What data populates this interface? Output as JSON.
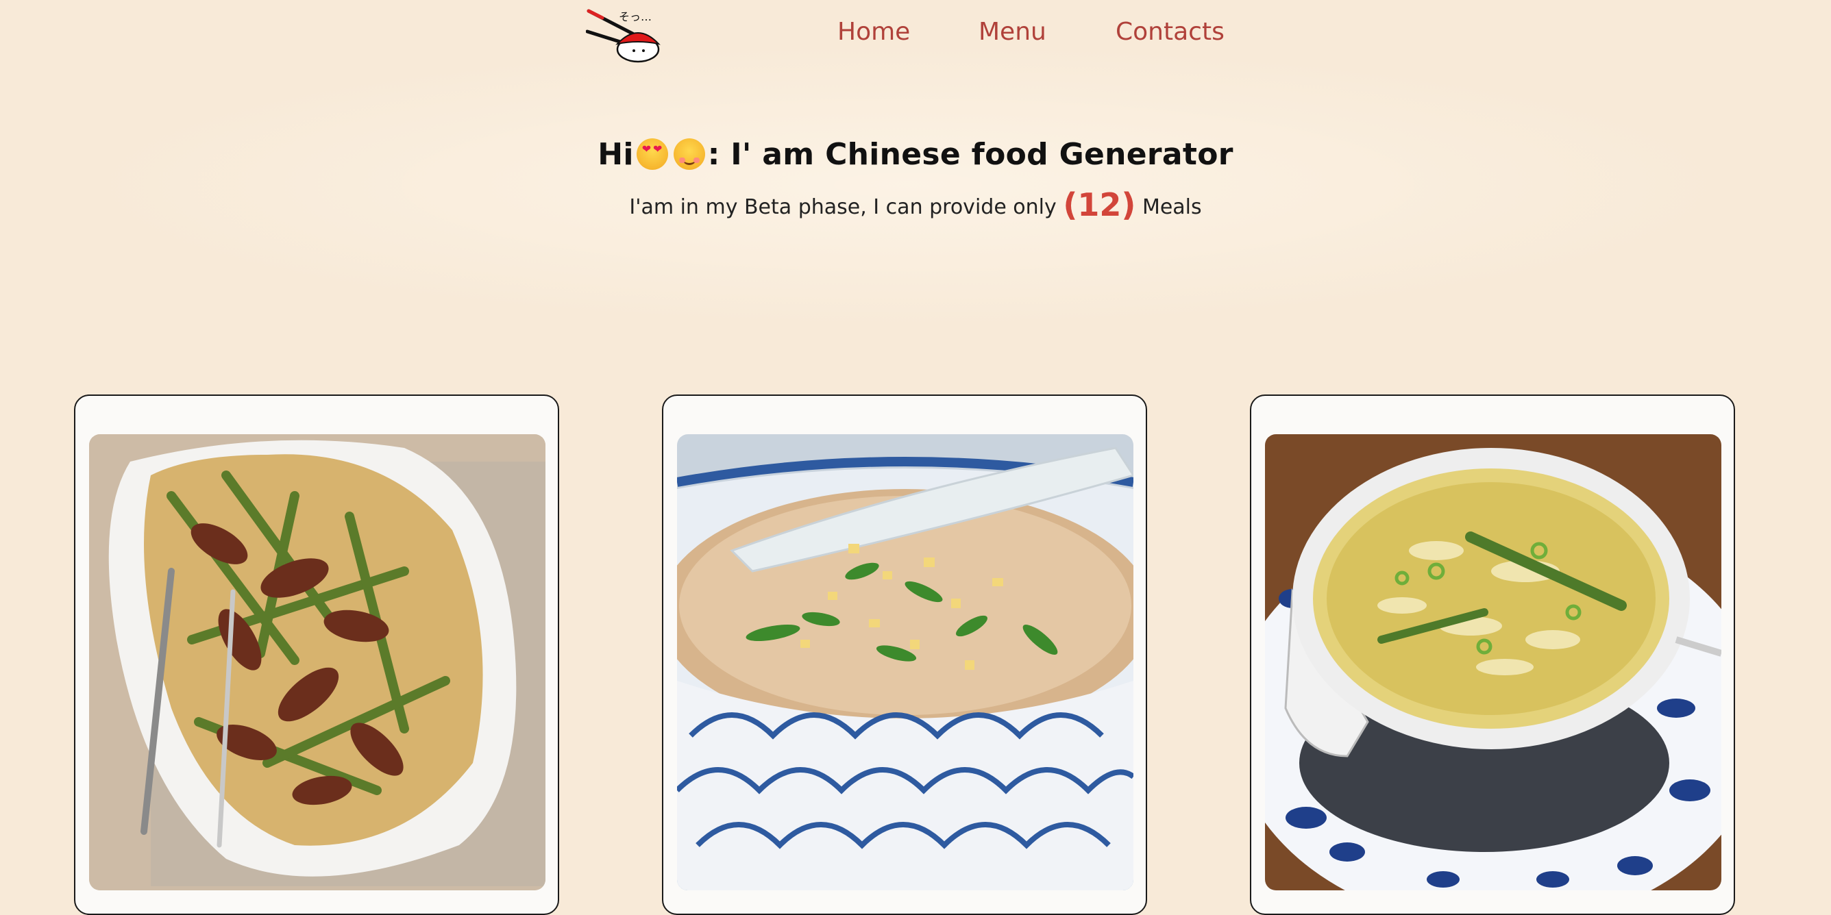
{
  "nav": {
    "logo_icon": "sushi-chopsticks-logo-icon",
    "logo_text": "そっ…",
    "links": [
      {
        "label": "Home"
      },
      {
        "label": "Menu"
      },
      {
        "label": "Contacts"
      }
    ]
  },
  "hero": {
    "title_prefix": "Hi",
    "emoji_1": "smiling-face-with-heart-eyes-icon",
    "emoji_2": "smiling-face-icon",
    "title_suffix": ": I' am Chinese food Generator",
    "subtitle_before": "I'am in my Beta phase, I can provide only",
    "meal_count": "(12)",
    "subtitle_after": "Meals"
  },
  "meals": [
    {
      "image": "beef-asparagus-noodles-photo"
    },
    {
      "image": "congee-rice-porridge-photo"
    },
    {
      "image": "egg-drop-soup-photo"
    }
  ],
  "colors": {
    "background": "#f8ead8",
    "nav_link": "#b0413a",
    "accent": "#d2453a",
    "card_border": "#1a1a1a"
  }
}
